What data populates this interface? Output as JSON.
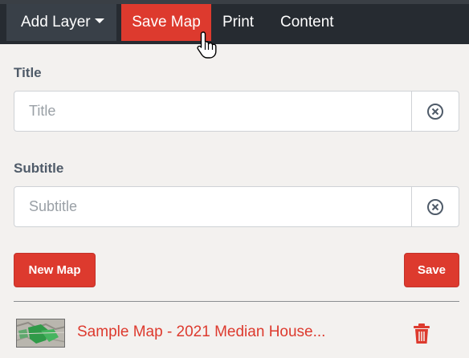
{
  "nav": {
    "add_layer": "Add Layer",
    "save_map": "Save Map",
    "print": "Print",
    "content": "Content"
  },
  "form": {
    "title_label": "Title",
    "title_placeholder": "Title",
    "subtitle_label": "Subtitle",
    "subtitle_placeholder": "Subtitle",
    "clear_icon": "circle-x-icon"
  },
  "buttons": {
    "new_map": "New Map",
    "save": "Save"
  },
  "maps": [
    {
      "name": "Sample Map - 2021 Median House..."
    }
  ],
  "colors": {
    "accent": "#dd3a2e",
    "topbar": "#262b31",
    "background": "#f3f1ef",
    "label": "#4f5b69"
  }
}
